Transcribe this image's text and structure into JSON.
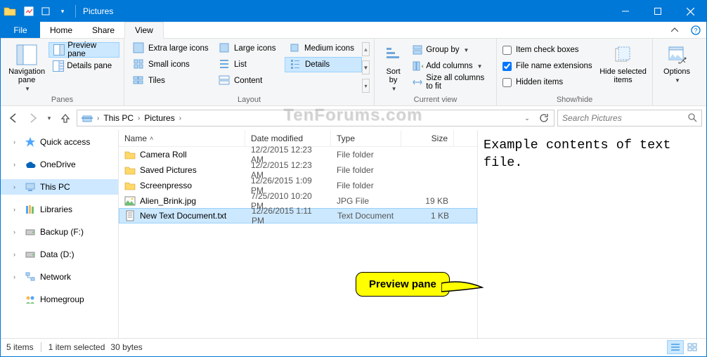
{
  "window": {
    "title": "Pictures"
  },
  "tabs": {
    "file": "File",
    "home": "Home",
    "share": "Share",
    "view": "View"
  },
  "ribbon": {
    "panes": {
      "navigation": "Navigation\npane",
      "preview": "Preview pane",
      "details": "Details pane",
      "group": "Panes"
    },
    "layout": {
      "xlarge": "Extra large icons",
      "large": "Large icons",
      "medium": "Medium icons",
      "small": "Small icons",
      "list": "List",
      "details": "Details",
      "tiles": "Tiles",
      "content": "Content",
      "group": "Layout"
    },
    "currentview": {
      "sortby": "Sort\nby",
      "groupby": "Group by",
      "addcols": "Add columns",
      "sizeall": "Size all columns to fit",
      "group": "Current view"
    },
    "showhide": {
      "checkboxes": "Item check boxes",
      "extensions": "File name extensions",
      "hidden": "Hidden items",
      "hidesel": "Hide selected\nitems",
      "group": "Show/hide"
    },
    "options": "Options"
  },
  "breadcrumb": {
    "root": "This PC",
    "leaf": "Pictures",
    "search_placeholder": "Search Pictures"
  },
  "sidebar": {
    "quick": "Quick access",
    "onedrive": "OneDrive",
    "thispc": "This PC",
    "libraries": "Libraries",
    "backup": "Backup (F:)",
    "data": "Data (D:)",
    "network": "Network",
    "homegroup": "Homegroup"
  },
  "columns": {
    "name": "Name",
    "date": "Date modified",
    "type": "Type",
    "size": "Size"
  },
  "files": [
    {
      "name": "Camera Roll",
      "date": "12/2/2015 12:23 AM",
      "type": "File folder",
      "size": "",
      "icon": "folder"
    },
    {
      "name": "Saved Pictures",
      "date": "12/2/2015 12:23 AM",
      "type": "File folder",
      "size": "",
      "icon": "folder"
    },
    {
      "name": "Screenpresso",
      "date": "12/26/2015 1:09 PM",
      "type": "File folder",
      "size": "",
      "icon": "folder"
    },
    {
      "name": "Alien_Brink.jpg",
      "date": "7/25/2010 10:20 PM",
      "type": "JPG File",
      "size": "19 KB",
      "icon": "image"
    },
    {
      "name": "New Text Document.txt",
      "date": "12/26/2015 1:11 PM",
      "type": "Text Document",
      "size": "1 KB",
      "icon": "text",
      "selected": true
    }
  ],
  "preview_text": "Example contents of text file.",
  "status": {
    "count": "5 items",
    "selection": "1 item selected",
    "size": "30 bytes"
  },
  "callout": "Preview pane",
  "checkstates": {
    "checkboxes": false,
    "extensions": true,
    "hidden": false
  },
  "watermark": "TenForums.com"
}
